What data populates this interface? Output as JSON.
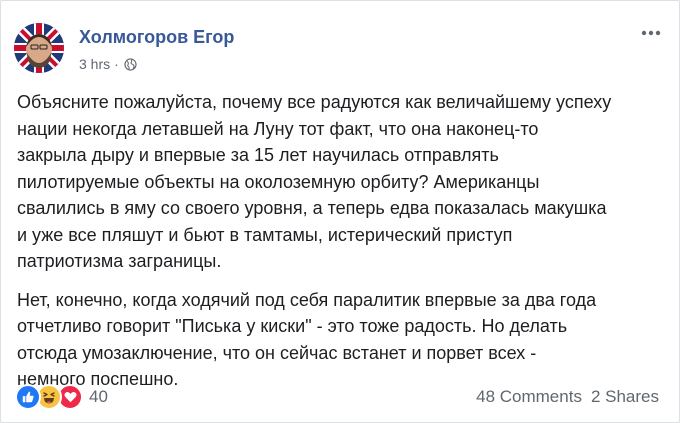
{
  "post": {
    "author": "Холмогоров Егор",
    "time": "3 hrs",
    "separator": "·",
    "privacy_icon": "globe-icon",
    "more_icon": "more-horizontal-icon",
    "body_paragraphs": [
      "Объясните пожалуйста, почему все радуются как величайшему успеху\nнации некогда летавшей на Луну тот факт, что она наконец-то\nзакрыла дыру и впервые за 15 лет научилась отправлять\nпилотируемые объекты на околоземную орбиту? Американцы\nсвалились в яму со своего уровня, а теперь едва показалась макушка\nи уже все пляшут и бьют в тамтамы, истерический приступ\nпатриотизма заграницы.",
      "Нет, конечно, когда ходячий под себя паралитик впервые за два года\nотчетливо говорит \"Писька у киски\" - это тоже радость. Но делать\nотсюда умозаключение, что он сейчас встанет и порвет всех -\nнемного поспешно."
    ]
  },
  "footer": {
    "reactions": [
      "like-reaction-icon",
      "haha-reaction-icon",
      "love-reaction-icon"
    ],
    "reaction_count": "40",
    "comments": "48 Comments",
    "shares": "2 Shares"
  },
  "colors": {
    "author_link": "#385898",
    "secondary_text": "#606770",
    "body_text": "#1c1e21",
    "like_blue": "#2078f4",
    "haha_yellow": "#f7c343",
    "love_red": "#f0284a"
  }
}
